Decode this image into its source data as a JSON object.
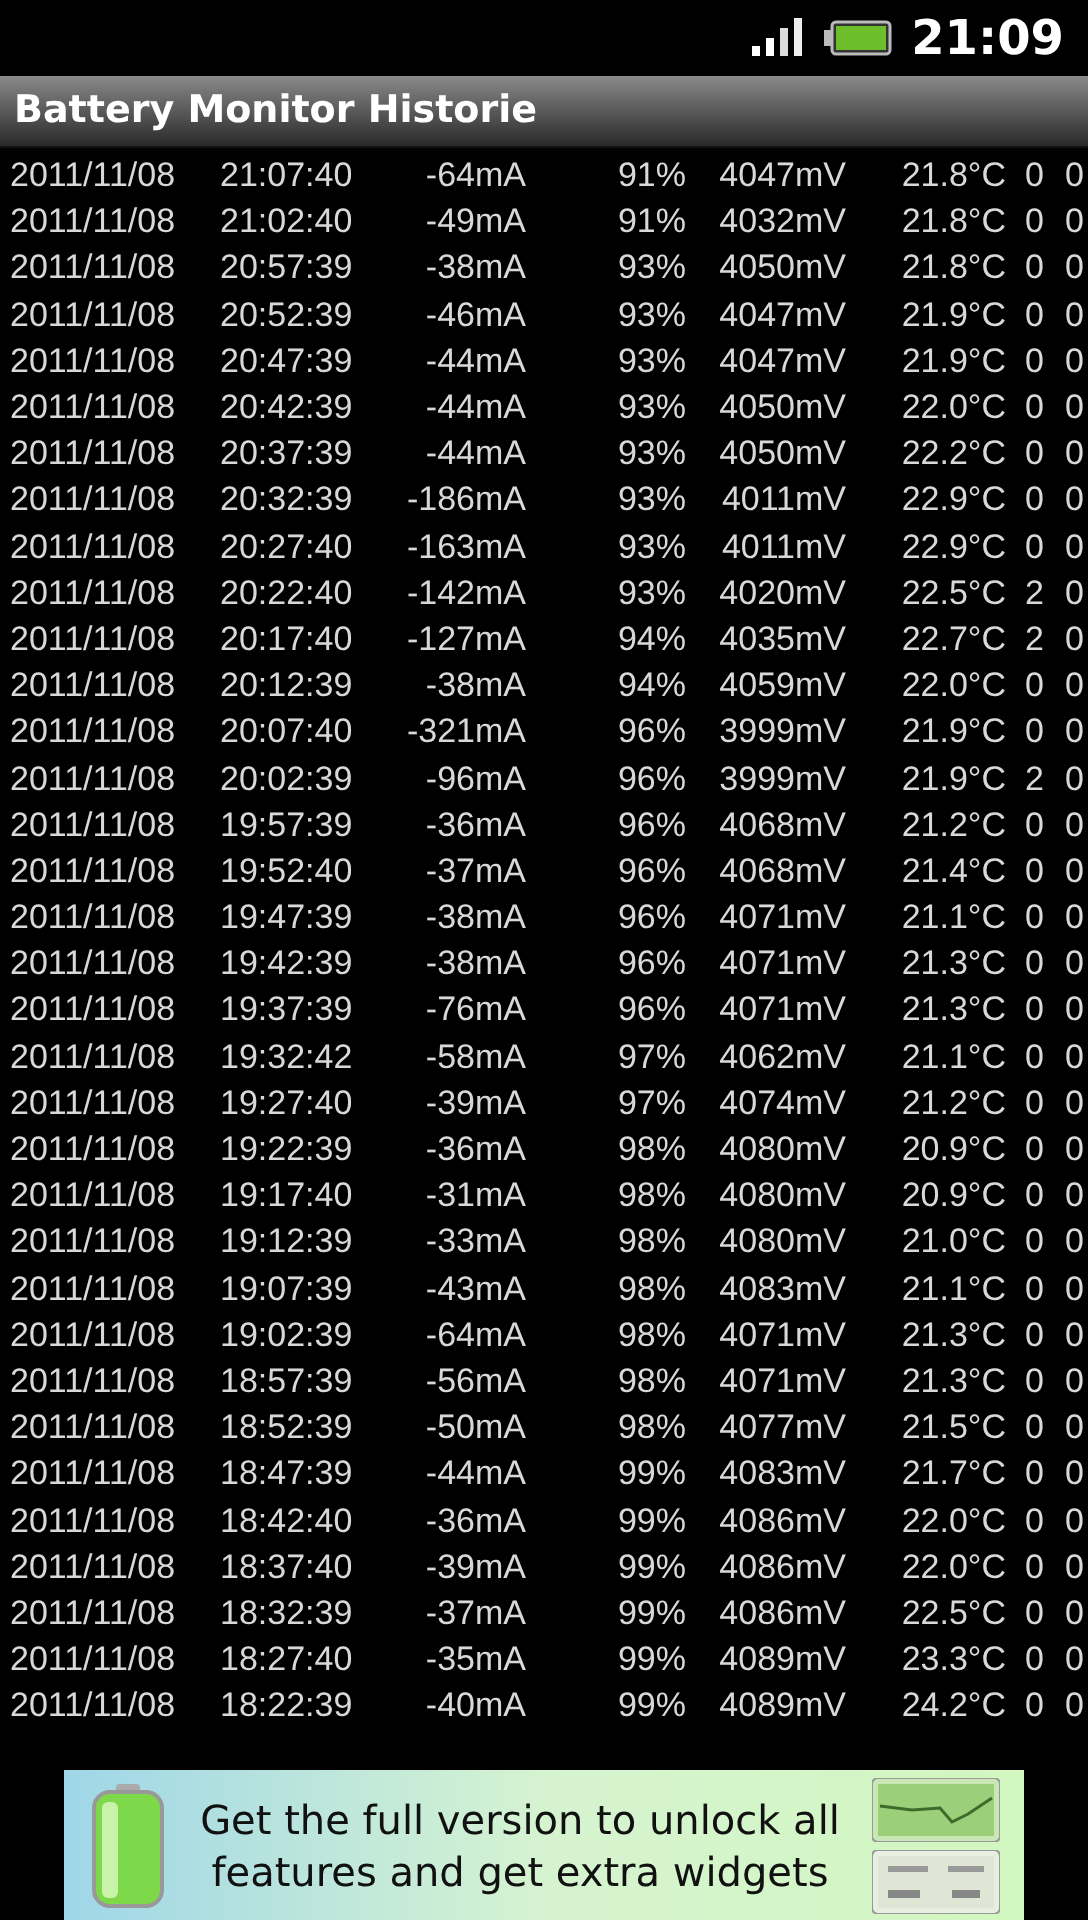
{
  "status_bar": {
    "time": "21:09"
  },
  "title": "Battery Monitor Historie",
  "rows": [
    {
      "date": "2011/11/08",
      "time": "21:07:40",
      "current": "-64mA",
      "percent": "91%",
      "voltage": "4047mV",
      "temperature": "21.8°C",
      "column_7": "0",
      "column_8": "0"
    },
    {
      "date": "2011/11/08",
      "time": "21:02:40",
      "current": "-49mA",
      "percent": "91%",
      "voltage": "4032mV",
      "temperature": "21.8°C",
      "column_7": "0",
      "column_8": "0"
    },
    {
      "date": "2011/11/08",
      "time": "20:57:39",
      "current": "-38mA",
      "percent": "93%",
      "voltage": "4050mV",
      "temperature": "21.8°C",
      "column_7": "0",
      "column_8": "0"
    },
    {
      "date": "2011/11/08",
      "time": "20:52:39",
      "current": "-46mA",
      "percent": "93%",
      "voltage": "4047mV",
      "temperature": "21.9°C",
      "column_7": "0",
      "column_8": "0"
    },
    {
      "date": "2011/11/08",
      "time": "20:47:39",
      "current": "-44mA",
      "percent": "93%",
      "voltage": "4047mV",
      "temperature": "21.9°C",
      "column_7": "0",
      "column_8": "0"
    },
    {
      "date": "2011/11/08",
      "time": "20:42:39",
      "current": "-44mA",
      "percent": "93%",
      "voltage": "4050mV",
      "temperature": "22.0°C",
      "column_7": "0",
      "column_8": "0"
    },
    {
      "date": "2011/11/08",
      "time": "20:37:39",
      "current": "-44mA",
      "percent": "93%",
      "voltage": "4050mV",
      "temperature": "22.2°C",
      "column_7": "0",
      "column_8": "0"
    },
    {
      "date": "2011/11/08",
      "time": "20:32:39",
      "current": "-186mA",
      "percent": "93%",
      "voltage": "4011mV",
      "temperature": "22.9°C",
      "column_7": "0",
      "column_8": "0"
    },
    {
      "date": "2011/11/08",
      "time": "20:27:40",
      "current": "-163mA",
      "percent": "93%",
      "voltage": "4011mV",
      "temperature": "22.9°C",
      "column_7": "0",
      "column_8": "0"
    },
    {
      "date": "2011/11/08",
      "time": "20:22:40",
      "current": "-142mA",
      "percent": "93%",
      "voltage": "4020mV",
      "temperature": "22.5°C",
      "column_7": "2",
      "column_8": "0"
    },
    {
      "date": "2011/11/08",
      "time": "20:17:40",
      "current": "-127mA",
      "percent": "94%",
      "voltage": "4035mV",
      "temperature": "22.7°C",
      "column_7": "2",
      "column_8": "0"
    },
    {
      "date": "2011/11/08",
      "time": "20:12:39",
      "current": "-38mA",
      "percent": "94%",
      "voltage": "4059mV",
      "temperature": "22.0°C",
      "column_7": "0",
      "column_8": "0"
    },
    {
      "date": "2011/11/08",
      "time": "20:07:40",
      "current": "-321mA",
      "percent": "96%",
      "voltage": "3999mV",
      "temperature": "21.9°C",
      "column_7": "0",
      "column_8": "0"
    },
    {
      "date": "2011/11/08",
      "time": "20:02:39",
      "current": "-96mA",
      "percent": "96%",
      "voltage": "3999mV",
      "temperature": "21.9°C",
      "column_7": "2",
      "column_8": "0"
    },
    {
      "date": "2011/11/08",
      "time": "19:57:39",
      "current": "-36mA",
      "percent": "96%",
      "voltage": "4068mV",
      "temperature": "21.2°C",
      "column_7": "0",
      "column_8": "0"
    },
    {
      "date": "2011/11/08",
      "time": "19:52:40",
      "current": "-37mA",
      "percent": "96%",
      "voltage": "4068mV",
      "temperature": "21.4°C",
      "column_7": "0",
      "column_8": "0"
    },
    {
      "date": "2011/11/08",
      "time": "19:47:39",
      "current": "-38mA",
      "percent": "96%",
      "voltage": "4071mV",
      "temperature": "21.1°C",
      "column_7": "0",
      "column_8": "0"
    },
    {
      "date": "2011/11/08",
      "time": "19:42:39",
      "current": "-38mA",
      "percent": "96%",
      "voltage": "4071mV",
      "temperature": "21.3°C",
      "column_7": "0",
      "column_8": "0"
    },
    {
      "date": "2011/11/08",
      "time": "19:37:39",
      "current": "-76mA",
      "percent": "96%",
      "voltage": "4071mV",
      "temperature": "21.3°C",
      "column_7": "0",
      "column_8": "0"
    },
    {
      "date": "2011/11/08",
      "time": "19:32:42",
      "current": "-58mA",
      "percent": "97%",
      "voltage": "4062mV",
      "temperature": "21.1°C",
      "column_7": "0",
      "column_8": "0"
    },
    {
      "date": "2011/11/08",
      "time": "19:27:40",
      "current": "-39mA",
      "percent": "97%",
      "voltage": "4074mV",
      "temperature": "21.2°C",
      "column_7": "0",
      "column_8": "0"
    },
    {
      "date": "2011/11/08",
      "time": "19:22:39",
      "current": "-36mA",
      "percent": "98%",
      "voltage": "4080mV",
      "temperature": "20.9°C",
      "column_7": "0",
      "column_8": "0"
    },
    {
      "date": "2011/11/08",
      "time": "19:17:40",
      "current": "-31mA",
      "percent": "98%",
      "voltage": "4080mV",
      "temperature": "20.9°C",
      "column_7": "0",
      "column_8": "0"
    },
    {
      "date": "2011/11/08",
      "time": "19:12:39",
      "current": "-33mA",
      "percent": "98%",
      "voltage": "4080mV",
      "temperature": "21.0°C",
      "column_7": "0",
      "column_8": "0"
    },
    {
      "date": "2011/11/08",
      "time": "19:07:39",
      "current": "-43mA",
      "percent": "98%",
      "voltage": "4083mV",
      "temperature": "21.1°C",
      "column_7": "0",
      "column_8": "0"
    },
    {
      "date": "2011/11/08",
      "time": "19:02:39",
      "current": "-64mA",
      "percent": "98%",
      "voltage": "4071mV",
      "temperature": "21.3°C",
      "column_7": "0",
      "column_8": "0"
    },
    {
      "date": "2011/11/08",
      "time": "18:57:39",
      "current": "-56mA",
      "percent": "98%",
      "voltage": "4071mV",
      "temperature": "21.3°C",
      "column_7": "0",
      "column_8": "0"
    },
    {
      "date": "2011/11/08",
      "time": "18:52:39",
      "current": "-50mA",
      "percent": "98%",
      "voltage": "4077mV",
      "temperature": "21.5°C",
      "column_7": "0",
      "column_8": "0"
    },
    {
      "date": "2011/11/08",
      "time": "18:47:39",
      "current": "-44mA",
      "percent": "99%",
      "voltage": "4083mV",
      "temperature": "21.7°C",
      "column_7": "0",
      "column_8": "0"
    },
    {
      "date": "2011/11/08",
      "time": "18:42:40",
      "current": "-36mA",
      "percent": "99%",
      "voltage": "4086mV",
      "temperature": "22.0°C",
      "column_7": "0",
      "column_8": "0"
    },
    {
      "date": "2011/11/08",
      "time": "18:37:40",
      "current": "-39mA",
      "percent": "99%",
      "voltage": "4086mV",
      "temperature": "22.0°C",
      "column_7": "0",
      "column_8": "0"
    },
    {
      "date": "2011/11/08",
      "time": "18:32:39",
      "current": "-37mA",
      "percent": "99%",
      "voltage": "4086mV",
      "temperature": "22.5°C",
      "column_7": "0",
      "column_8": "0"
    },
    {
      "date": "2011/11/08",
      "time": "18:27:40",
      "current": "-35mA",
      "percent": "99%",
      "voltage": "4089mV",
      "temperature": "23.3°C",
      "column_7": "0",
      "column_8": "0"
    },
    {
      "date": "2011/11/08",
      "time": "18:22:39",
      "current": "-40mA",
      "percent": "99%",
      "voltage": "4089mV",
      "temperature": "24.2°C",
      "column_7": "0",
      "column_8": "0"
    }
  ],
  "ad_banner": {
    "text": "Get the full version to unlock all features and get extra widgets"
  }
}
